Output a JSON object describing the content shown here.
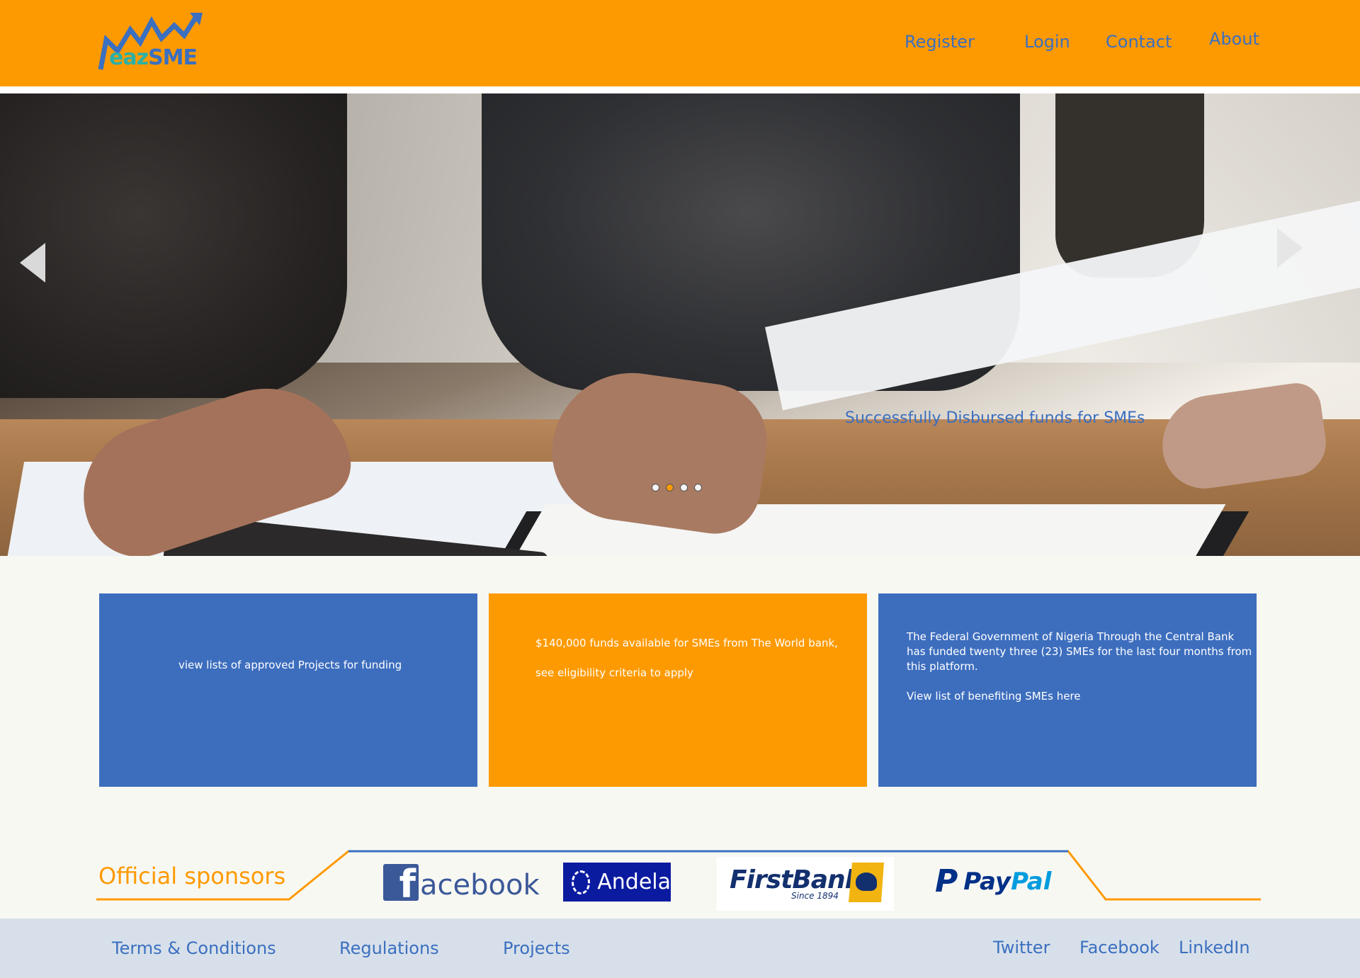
{
  "header": {
    "logo": {
      "part1": "eaz",
      "part2": "SME"
    },
    "nav": [
      {
        "label": "Register"
      },
      {
        "label": "Login"
      },
      {
        "label": "Contact"
      },
      {
        "label": "About"
      }
    ]
  },
  "hero": {
    "caption": "Successfully Disbursed funds for SMEs",
    "prev_icon": "chevron-left-icon",
    "next_icon": "chevron-right-icon",
    "slides_count": 4,
    "active_slide": 2
  },
  "cards": [
    {
      "lines": [
        "view lists of approved Projects for funding"
      ]
    },
    {
      "lines": [
        "$140,000 funds available for SMEs from The World bank,",
        "see eligibility criteria to apply"
      ]
    },
    {
      "lines": [
        "The Federal Government of Nigeria Through the Central Bank",
        "has funded twenty three (23) SMEs for the last four months from",
        "this platform.",
        "View list of benefiting SMEs here"
      ]
    }
  ],
  "sponsors": {
    "title": "Official sponsors",
    "facebook": {
      "mark": "f",
      "text": "acebook"
    },
    "andela": {
      "text": "Andela"
    },
    "firstbank": {
      "text": "FirstBank",
      "since": "Since 1894"
    },
    "paypal": {
      "mark": "P",
      "pay": "Pay",
      "pal": "Pal"
    }
  },
  "footer": {
    "left_links": [
      {
        "label": "Terms & Conditions"
      },
      {
        "label": "Regulations"
      },
      {
        "label": "Projects"
      }
    ],
    "right_links": [
      {
        "label": "Twitter"
      },
      {
        "label": "Facebook"
      },
      {
        "label": "LinkedIn"
      }
    ]
  },
  "colors": {
    "brand_orange": "#fe9a01",
    "brand_blue": "#3d6ebe",
    "footer_bg": "#d7e0ea",
    "page_bg": "#f8f8f3"
  }
}
